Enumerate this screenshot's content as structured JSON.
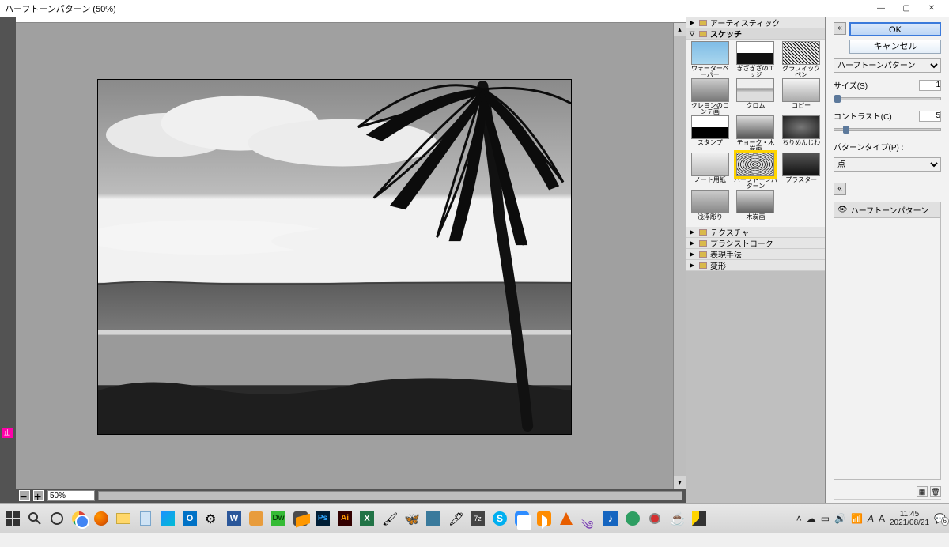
{
  "window": {
    "title": "ハーフトーンパターン (50%)"
  },
  "zoom": {
    "value": "50%"
  },
  "categories": {
    "artistic": "アーティスティック",
    "sketch": "スケッチ",
    "texture": "テクスチャ",
    "brush": "ブラシストローク",
    "style": "表現手法",
    "distort": "変形"
  },
  "thumbs": [
    {
      "label": "ウォーターペーパー"
    },
    {
      "label": "ぎざぎざのエッジ"
    },
    {
      "label": "グラフィックペン"
    },
    {
      "label": "クレヨンのコンテ画"
    },
    {
      "label": "クロム"
    },
    {
      "label": "コピー"
    },
    {
      "label": "スタンプ"
    },
    {
      "label": "チョーク・木炭画"
    },
    {
      "label": "ちりめんじわ"
    },
    {
      "label": "ノート用紙"
    },
    {
      "label": "ハーフトーンパターン"
    },
    {
      "label": "プラスター"
    },
    {
      "label": "浅浮彫り"
    },
    {
      "label": "木炭画"
    }
  ],
  "settings": {
    "ok": "OK",
    "cancel": "キャンセル",
    "filterName": "ハーフトーンパターン",
    "size_label": "サイズ(S)",
    "size_value": "1",
    "contrast_label": "コントラスト(C)",
    "contrast_value": "5",
    "pattern_label": "パターンタイプ(P) :",
    "pattern_value": "点",
    "preview_title": "ハーフトーンパターン"
  },
  "taskbar": {
    "time": "11:45",
    "date": "2021/08/21",
    "notif_count": "6"
  },
  "stop_badge": "止"
}
